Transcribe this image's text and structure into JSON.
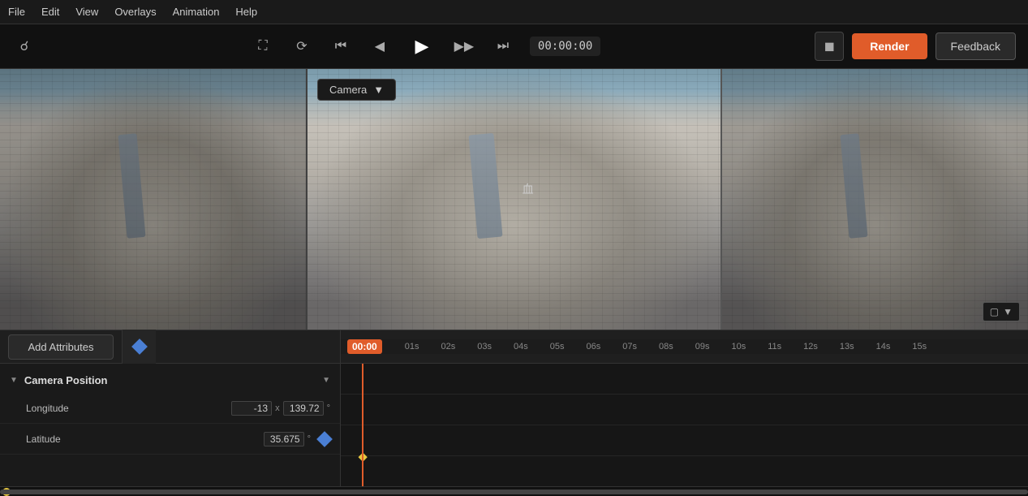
{
  "menu": {
    "items": [
      "File",
      "Edit",
      "View",
      "Overlays",
      "Animation",
      "Help"
    ]
  },
  "toolbar": {
    "time": "00:00:00",
    "render_label": "Render",
    "feedback_label": "Feedback"
  },
  "viewport": {
    "camera_label": "Camera",
    "cursor_char": "↖"
  },
  "timeline": {
    "add_attributes_label": "Add Attributes",
    "current_time": "00:00",
    "time_marks": [
      "01s",
      "02s",
      "03s",
      "04s",
      "05s",
      "06s",
      "07s",
      "08s",
      "09s",
      "10s",
      "11s",
      "12s",
      "13s",
      "14s",
      "15s"
    ],
    "section": {
      "title": "Camera Position",
      "attrs": [
        {
          "name": "Longitude",
          "value_x": "-13",
          "x_label": "x",
          "value_num": "139.72",
          "deg": "°",
          "has_keyframe": false
        },
        {
          "name": "Latitude",
          "value_num": "35.675",
          "deg": "°",
          "has_keyframe": true
        }
      ]
    }
  }
}
